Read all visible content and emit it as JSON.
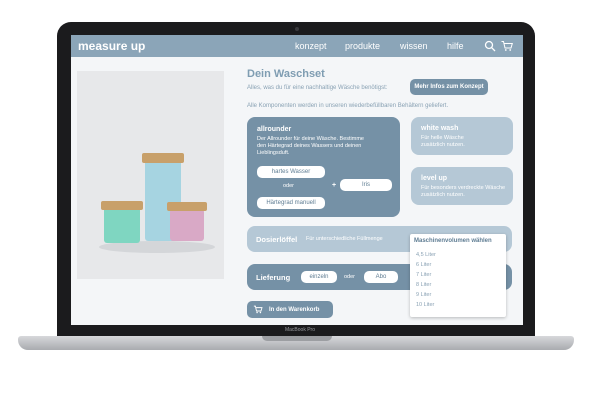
{
  "device": {
    "model_label": "MacBook Pro"
  },
  "nav": {
    "logo": "measure up",
    "links": [
      "konzept",
      "produkte",
      "wissen",
      "hilfe"
    ]
  },
  "header": {
    "title": "Dein Waschset",
    "intro": "Alles, was du für eine nachhaltige Wäsche benötigst:",
    "info_button": "Mehr Infos zum Konzept",
    "refill_note": "Alle Komponenten werden in unseren wiederbefüllbaren Behältern geliefert."
  },
  "allrounder": {
    "title": "allrounder",
    "text": "Der Allrounder für deine Wäsche. Bestimme den Härtegrad deines Wassers und deinen Lieblingsduft.",
    "hard_water": "hartes Wasser",
    "or": "oder",
    "manual": "Härtegrad manuell",
    "plus": "+",
    "scent": "Iris"
  },
  "white_wash": {
    "title": "white wash",
    "text": "Für helle Wäsche zusätzlich nutzen."
  },
  "level_up": {
    "title": "level up",
    "text": "Für besonders verdreckte Wäsche zusätzlich nutzen."
  },
  "dosing": {
    "title": "Dosierlöffel",
    "subtitle": "Für unterschiedliche Füllmenge",
    "dropdown_label": "Maschinenvolumen wählen",
    "options": [
      "4,5 Liter",
      "6 Liter",
      "7 Liter",
      "8 Liter",
      "9 Liter",
      "10 Liter"
    ]
  },
  "delivery": {
    "title": "Lieferung",
    "single": "einzeln",
    "or": "oder",
    "subscription": "Abo"
  },
  "cart_button": "In den Warenkorb",
  "colors": {
    "primary": "#7591a6",
    "light": "#b5c8d6",
    "nav": "#8ba5b8"
  }
}
